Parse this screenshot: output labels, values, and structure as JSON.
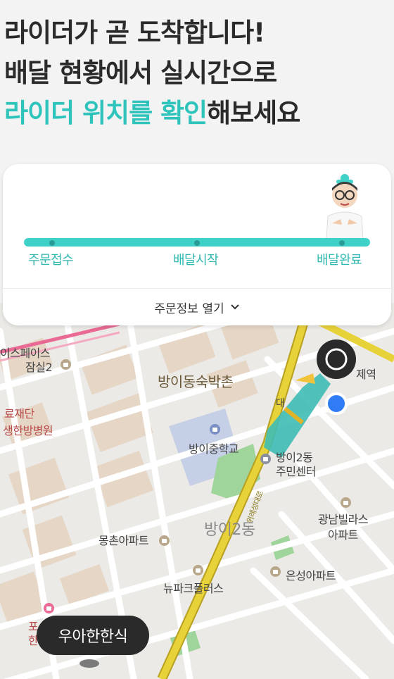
{
  "headline": {
    "line1": "라이더가 곧 도착합니다!",
    "line2": "배달 현황에서 실시간으로",
    "line3_accent": "라이더 위치를 확인",
    "line3_rest": "해보세요"
  },
  "status_card": {
    "steps": [
      "주문접수",
      "배달시작",
      "배달완료"
    ],
    "toggle_label": "주문정보 열기",
    "progress_fraction": 1.0
  },
  "map": {
    "labels": {
      "space": "이스페이스",
      "jamsil": "잠실2",
      "foundation": "료재단",
      "hospital": "생한방병원",
      "village": "방이동숙박촌",
      "station": "제역",
      "station_prefix": "대",
      "school": "방이중학교",
      "community": "방이2동",
      "community2": "주민센터",
      "villa": "광남빌라스",
      "villa2": "아파트",
      "district": "방이2동",
      "mongchon": "몽촌아파트",
      "newpark": "뉴파크플러스",
      "eunseong": "은성아파트",
      "bottom1": "포",
      "bottom2": "한",
      "road": "위례성대로"
    },
    "store_bubble": "우아한한식"
  },
  "colors": {
    "accent": "#2ec4bc",
    "track": "#3fd0c7",
    "road_main": "#d9c230",
    "road_pink": "#e96a94",
    "park": "#9fd49a",
    "school_zone": "#c5cfe6"
  }
}
